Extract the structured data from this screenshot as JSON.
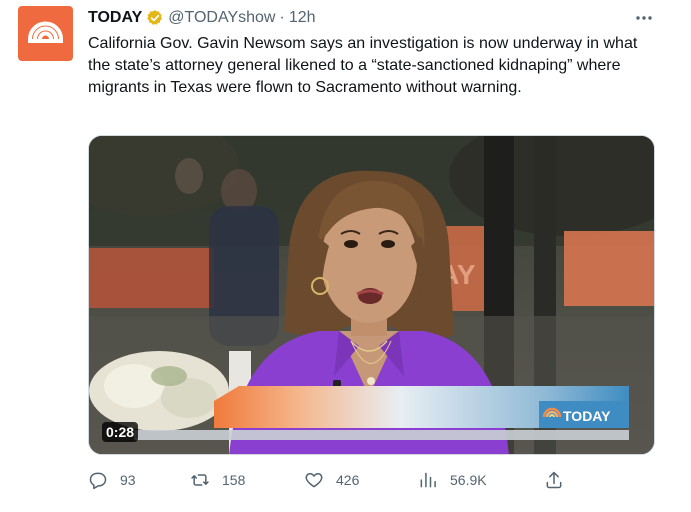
{
  "tweet": {
    "author_name": "TODAY",
    "handle": "@TODAYshow",
    "separator": "·",
    "time": "12h",
    "text": "California Gov. Gavin Newsom says an investigation is now underway in what the state’s attorney general likened to a “state-sanctioned kidnaping” where migrants in Texas were flown to Sacramento without warning."
  },
  "video": {
    "duration": "0:28",
    "banner_logo_text": "TODAY",
    "background_sign_text": "DAY"
  },
  "actions": {
    "replies": "93",
    "retweets": "158",
    "likes": "426",
    "views": "56.9K"
  },
  "colors": {
    "brand_orange": "#ef6b3f",
    "verified_gold": "#e2b719",
    "text_secondary": "#536471",
    "jacket_purple": "#8a3fd0"
  },
  "icons": [
    "today-logo-icon",
    "verified-badge-icon",
    "more-icon",
    "reply-icon",
    "retweet-icon",
    "like-icon",
    "views-icon",
    "share-icon"
  ]
}
